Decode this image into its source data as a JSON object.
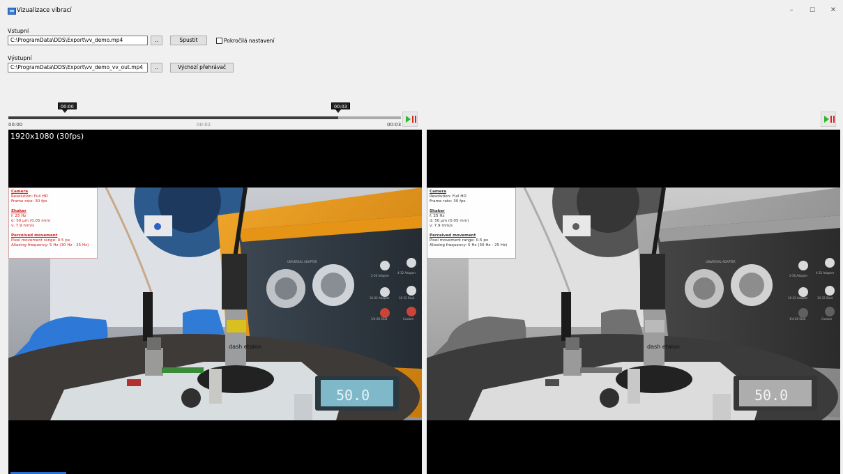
{
  "window": {
    "title": "Vizualizace vibrací",
    "minimize": "–",
    "maximize": "☐",
    "close": "✕"
  },
  "input": {
    "label": "Vstupní",
    "path": "C:\\ProgramData\\DDS\\Export\\vv_demo.mp4",
    "browse_label": "..",
    "run_label": "Spustit",
    "advanced_label": "Pokročilá nastavení",
    "advanced_checked": false
  },
  "output": {
    "label": "Výstupní",
    "path": "C:\\ProgramData\\DDS\\Export\\vv_demo_vv_out.mp4",
    "browse_label": "..",
    "default_player_label": "Výchozí přehrávač"
  },
  "timeline": {
    "start_marker": "00:00",
    "end_marker": "00:03",
    "tick_start": "00:00",
    "tick_mid": "00:02",
    "tick_end": "00:03",
    "selection_start_fraction": 0.0,
    "selection_end_fraction": 0.84
  },
  "left_video": {
    "resolution": "1920x1080 (30fps)"
  },
  "overlay": {
    "camera_title": "Camera",
    "camera_lines": [
      "Resolution: Full HD",
      "Frame rate: 30 fps"
    ],
    "shaker_title": "Shaker",
    "shaker_lines": [
      "f: 25 Hz",
      "d: 50 µm (0.05 mm)",
      "v: 7.9 mm/s"
    ],
    "perceived_title": "Perceived movement",
    "perceived_lines": [
      "Pixel movement range: 0.5 px",
      "Aliasing frequency: 5 Hz (30 Hz - 25 Hz)"
    ]
  },
  "scene_labels": {
    "device_title": "UNIVERSAL ADAPTER",
    "adapter_a": "2-56 Adapter",
    "adapter_b": "4-32 Adapter",
    "adapter_c": "10-32 Adapter",
    "adapter_d": "10-32 Stud",
    "adapter_e": "1/4-28 Stud",
    "adapter_f": "Custom",
    "etalon": "dash etalon",
    "display": "50.0"
  },
  "colors": {
    "overlay_text": "#d01b1b",
    "play": "#2eb82e",
    "pause": "#e02020",
    "video_bg": "#000000"
  },
  "icons": {
    "app": "app-icon",
    "play_pause": "play-pause-icon"
  }
}
